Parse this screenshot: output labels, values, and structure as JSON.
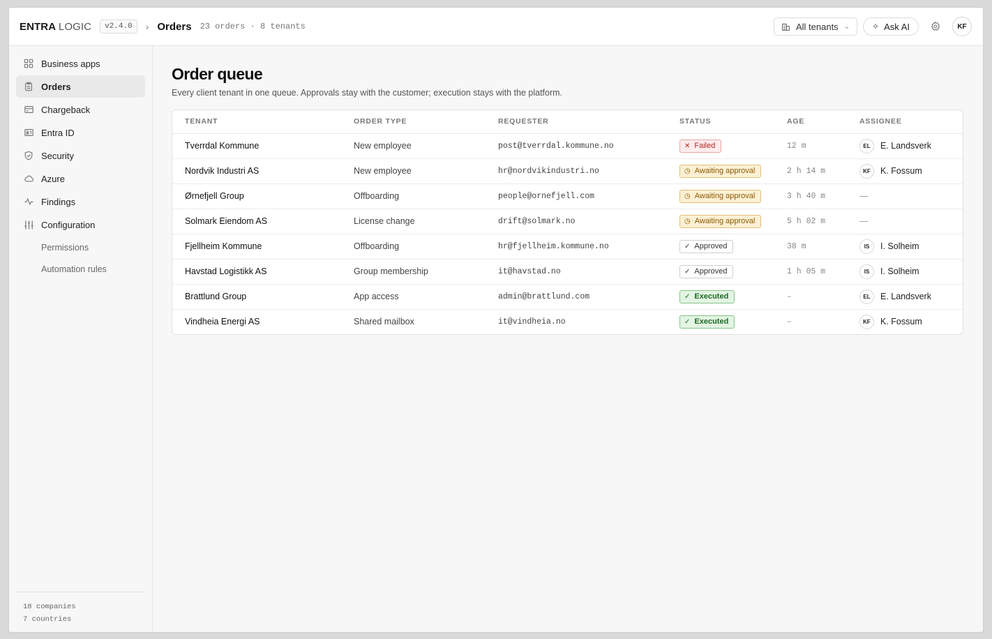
{
  "header": {
    "brand_bold": "ENTRA",
    "brand_light": "LOGIC",
    "version": "v2.4.0",
    "breadcrumb_sep": "›",
    "page": "Orders",
    "meta": "23 orders · 8 tenants",
    "tenant_filter": "All tenants",
    "ask_ai": "Ask AI",
    "user_initials": "KF"
  },
  "sidebar": {
    "items": [
      {
        "label": "Business apps",
        "icon": "grid-icon"
      },
      {
        "label": "Orders",
        "icon": "clipboard-icon",
        "active": true
      },
      {
        "label": "Chargeback",
        "icon": "credit-card-icon"
      },
      {
        "label": "Entra ID",
        "icon": "id-card-icon"
      },
      {
        "label": "Security",
        "icon": "shield-icon"
      },
      {
        "label": "Azure",
        "icon": "cloud-icon"
      },
      {
        "label": "Findings",
        "icon": "activity-icon"
      },
      {
        "label": "Configuration",
        "icon": "sliders-icon"
      }
    ],
    "subitems": [
      {
        "label": "Permissions"
      },
      {
        "label": "Automation rules"
      }
    ],
    "footer": {
      "line1": "18 companies",
      "line2": "7 countries"
    }
  },
  "main": {
    "title": "Order queue",
    "subtitle": "Every client tenant in one queue. Approvals stay with the customer; execution stays with the platform.",
    "columns": [
      "TENANT",
      "ORDER TYPE",
      "REQUESTER",
      "STATUS",
      "AGE",
      "ASSIGNEE"
    ],
    "rows": [
      {
        "tenant": "Tverrdal Kommune",
        "type": "New employee",
        "requester": "post@tverrdal.kommune.no",
        "status": "Failed",
        "status_kind": "failed",
        "status_icon": "✕",
        "age": "12 m",
        "assignee_initials": "EL",
        "assignee": "E. Landsverk"
      },
      {
        "tenant": "Nordvik Industri AS",
        "type": "New employee",
        "requester": "hr@nordvikindustri.no",
        "status": "Awaiting approval",
        "status_kind": "await",
        "status_icon": "◷",
        "age": "2 h 14 m",
        "assignee_initials": "KF",
        "assignee": "K. Fossum"
      },
      {
        "tenant": "Ørnefjell Group",
        "type": "Offboarding",
        "requester": "people@ornefjell.com",
        "status": "Awaiting approval",
        "status_kind": "await",
        "status_icon": "◷",
        "age": "3 h 40 m",
        "assignee_initials": "",
        "assignee": "—"
      },
      {
        "tenant": "Solmark Eiendom AS",
        "type": "License change",
        "requester": "drift@solmark.no",
        "status": "Awaiting approval",
        "status_kind": "await",
        "status_icon": "◷",
        "age": "5 h 02 m",
        "assignee_initials": "",
        "assignee": "—"
      },
      {
        "tenant": "Fjellheim Kommune",
        "type": "Offboarding",
        "requester": "hr@fjellheim.kommune.no",
        "status": "Approved",
        "status_kind": "approved",
        "status_icon": "✓",
        "age": "38 m",
        "assignee_initials": "IS",
        "assignee": "I. Solheim"
      },
      {
        "tenant": "Havstad Logistikk AS",
        "type": "Group membership",
        "requester": "it@havstad.no",
        "status": "Approved",
        "status_kind": "approved",
        "status_icon": "✓",
        "age": "1 h 05 m",
        "assignee_initials": "IS",
        "assignee": "I. Solheim"
      },
      {
        "tenant": "Brattlund Group",
        "type": "App access",
        "requester": "admin@brattlund.com",
        "status": "Executed",
        "status_kind": "executed",
        "status_icon": "✓",
        "age": "–",
        "assignee_initials": "EL",
        "assignee": "E. Landsverk"
      },
      {
        "tenant": "Vindheia Energi AS",
        "type": "Shared mailbox",
        "requester": "it@vindheia.no",
        "status": "Executed",
        "status_kind": "executed",
        "status_icon": "✓",
        "age": "–",
        "assignee_initials": "KF",
        "assignee": "K. Fossum"
      }
    ]
  }
}
